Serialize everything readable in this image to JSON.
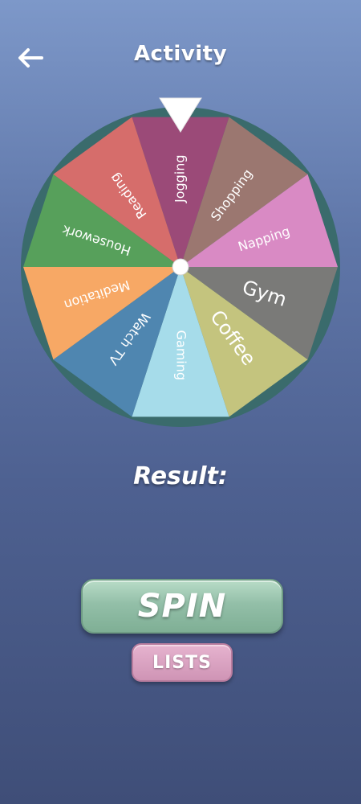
{
  "header": {
    "title": "Activity",
    "back_icon": "arrow-left-icon"
  },
  "wheel": {
    "segments": [
      {
        "label": "Jogging",
        "color": "#9b4a78"
      },
      {
        "label": "Shopping",
        "color": "#9b7770"
      },
      {
        "label": "Napping",
        "color": "#d98ac4"
      },
      {
        "label": "Gym",
        "color": "#7a7a78"
      },
      {
        "label": "Coffee",
        "color": "#c4c47e"
      },
      {
        "label": "Gaming",
        "color": "#a6dcea"
      },
      {
        "label": "Watch TV",
        "color": "#4f86b0"
      },
      {
        "label": "Meditation",
        "color": "#f7a865"
      },
      {
        "label": "Housework",
        "color": "#57a05b"
      },
      {
        "label": "Reading",
        "color": "#d66d6b"
      }
    ],
    "pointer_icon": "pointer-triangle-icon"
  },
  "result": {
    "label": "Result:"
  },
  "buttons": {
    "spin_label": "SPIN",
    "lists_label": "LISTS"
  }
}
